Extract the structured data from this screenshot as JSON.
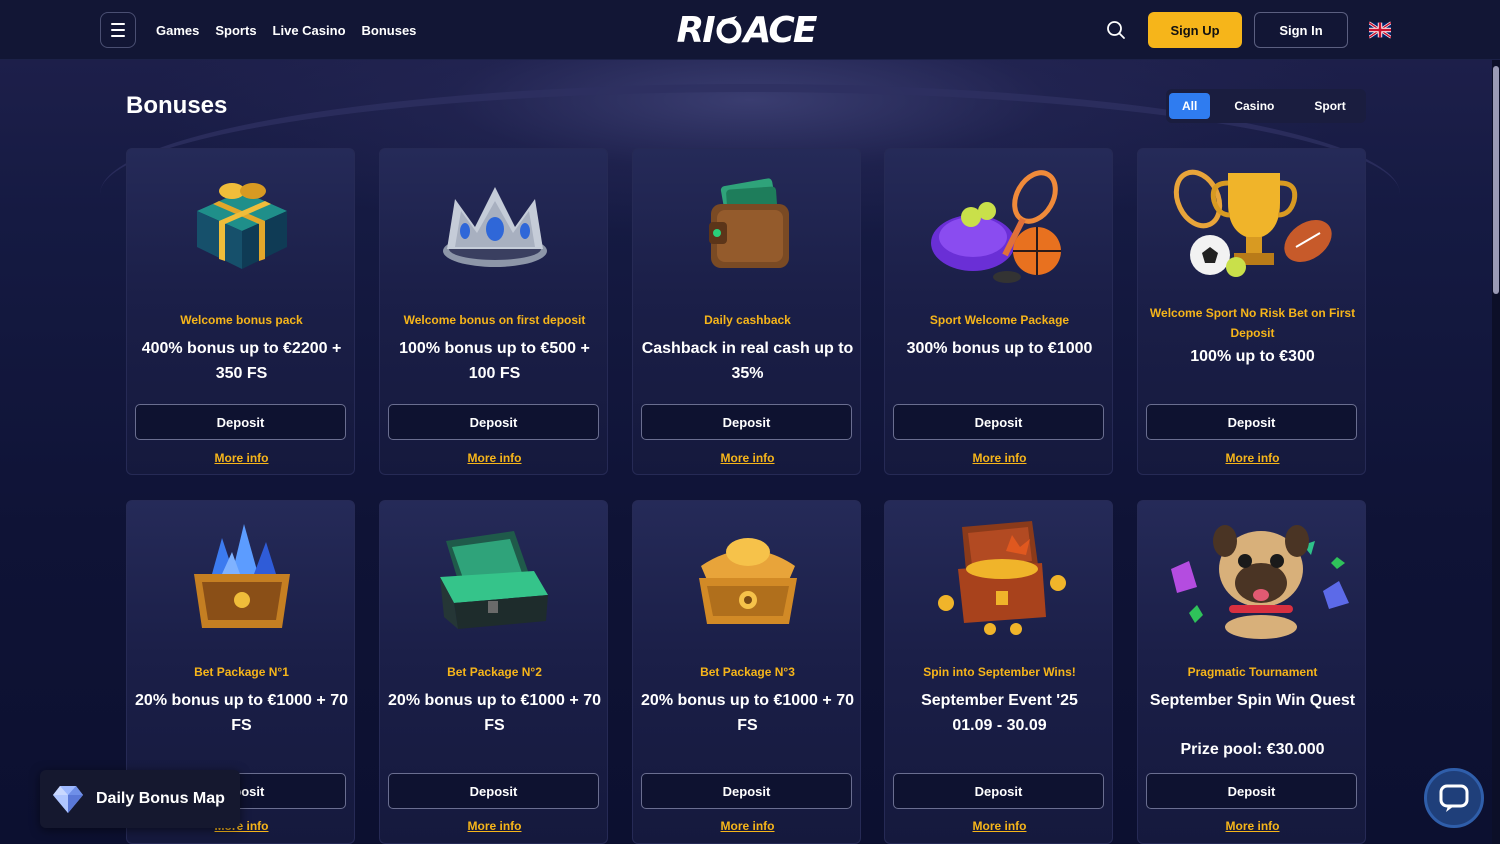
{
  "header": {
    "nav": [
      "Games",
      "Sports",
      "Live Casino",
      "Bonuses"
    ],
    "logo_left": "RI",
    "logo_right": "ACE",
    "sign_up": "Sign Up",
    "sign_in": "Sign In",
    "language_flag": "uk-flag-icon",
    "accent_color": "#f6b51a"
  },
  "page": {
    "title": "Bonuses",
    "filters": [
      "All",
      "Casino",
      "Sport"
    ],
    "active_filter": "All"
  },
  "cards": [
    {
      "icon": "gift-box-icon",
      "subtitle": "Welcome bonus pack",
      "title": "400% bonus up to €2200 + 350 FS",
      "button": "Deposit",
      "link": "More info"
    },
    {
      "icon": "crown-icon",
      "subtitle": "Welcome bonus on first deposit",
      "title": "100% bonus up to €500 + 100 FS",
      "button": "Deposit",
      "link": "More info"
    },
    {
      "icon": "wallet-icon",
      "subtitle": "Daily cashback",
      "title": "Cashback in real cash up to 35%",
      "button": "Deposit",
      "link": "More info"
    },
    {
      "icon": "sports-bag-icon",
      "subtitle": "Sport Welcome Package",
      "title": "300% bonus up to €1000",
      "button": "Deposit",
      "link": "More info"
    },
    {
      "icon": "trophy-icon",
      "subtitle": "Welcome Sport No Risk Bet on First Deposit",
      "title": "100% up to €300",
      "button": "Deposit",
      "link": "More info"
    },
    {
      "icon": "crystal-chest-icon",
      "subtitle": "Bet Package N°1",
      "title": "20% bonus up to €1000 + 70 FS",
      "button": "Deposit",
      "link": "More info"
    },
    {
      "icon": "money-chest-icon",
      "subtitle": "Bet Package N°2",
      "title": "20% bonus up to €1000 + 70 FS",
      "button": "Deposit",
      "link": "More info"
    },
    {
      "icon": "gold-chest-icon",
      "subtitle": "Bet Package N°3",
      "title": "20% bonus up to €1000 + 70 FS",
      "button": "Deposit",
      "link": "More info"
    },
    {
      "icon": "treasure-chest-icon",
      "subtitle": "Spin into September Wins!",
      "title": "September Event '25",
      "title2": "01.09 - 30.09",
      "button": "Deposit",
      "link": "More info"
    },
    {
      "icon": "pug-icon",
      "subtitle": "Pragmatic Tournament",
      "title": "September Spin Win Quest",
      "title2": "Prize pool: €30.000",
      "button": "Deposit",
      "link": "More info"
    }
  ],
  "floating": {
    "bonus_map_label": "Daily Bonus Map",
    "chat_icon": "chat-icon"
  }
}
